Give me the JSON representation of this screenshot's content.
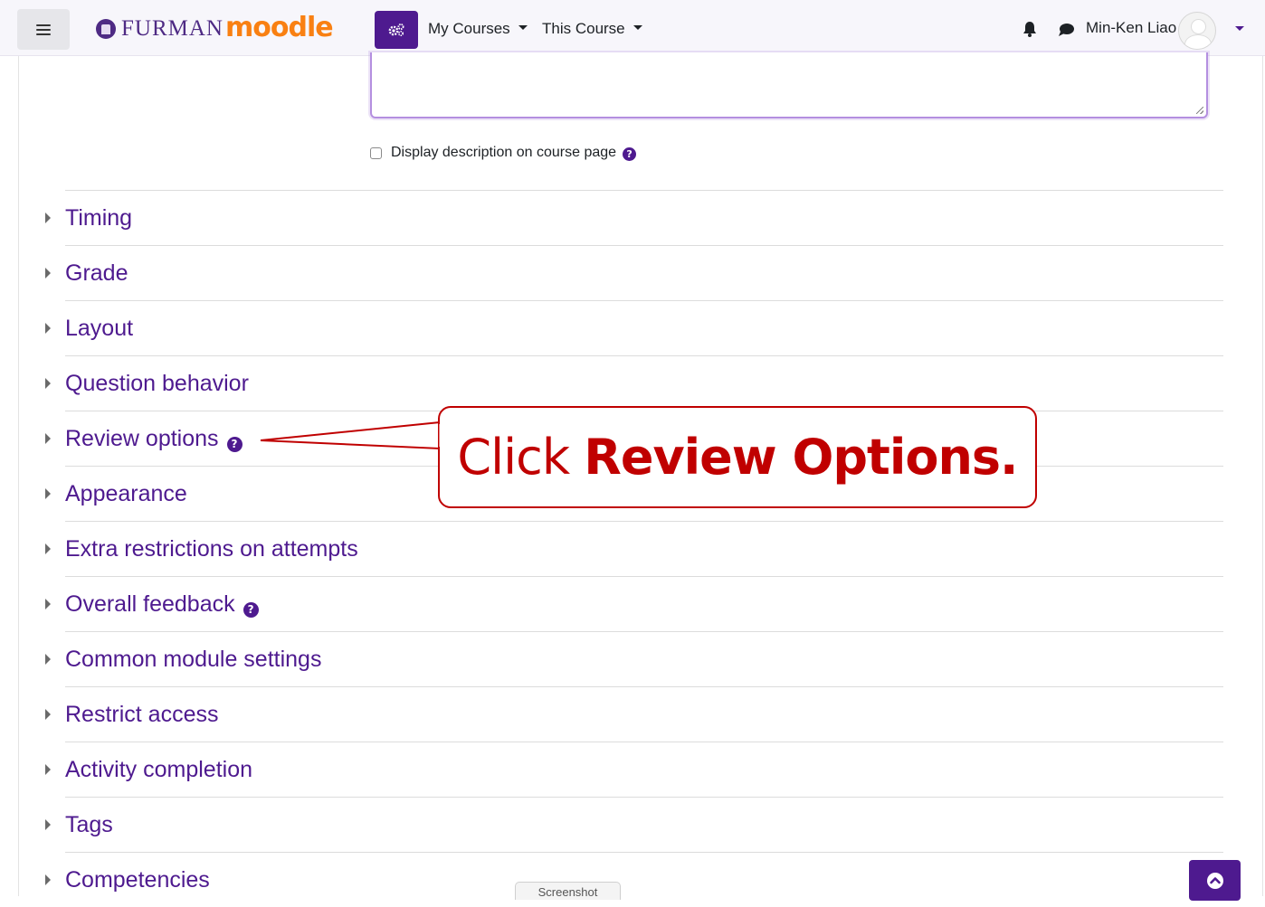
{
  "navbar": {
    "brand_furman": "FURMAN",
    "brand_moodle": "moodle",
    "my_courses": "My Courses",
    "this_course": "This Course",
    "user_name": "Min-Ken Liao"
  },
  "form": {
    "display_description_label": "Display description on course page"
  },
  "sections": [
    {
      "title": "Timing",
      "help": false
    },
    {
      "title": "Grade",
      "help": false
    },
    {
      "title": "Layout",
      "help": false
    },
    {
      "title": "Question behavior",
      "help": false
    },
    {
      "title": "Review options",
      "help": true
    },
    {
      "title": "Appearance",
      "help": false
    },
    {
      "title": "Extra restrictions on attempts",
      "help": false
    },
    {
      "title": "Overall feedback",
      "help": true
    },
    {
      "title": "Common module settings",
      "help": false
    },
    {
      "title": "Restrict access",
      "help": false
    },
    {
      "title": "Activity completion",
      "help": false
    },
    {
      "title": "Tags",
      "help": false
    },
    {
      "title": "Competencies",
      "help": false
    }
  ],
  "callout": {
    "prefix": "Click ",
    "emphasis": "Review Options."
  },
  "footer": {
    "screenshot_tab": "Screenshot"
  },
  "icons": {
    "help": "?",
    "menu": "hamburger-icon",
    "admin": "gears-icon",
    "notifications": "bell-icon",
    "messages": "chat-bubble-icon",
    "back_to_top": "arrow-up-icon"
  },
  "colors": {
    "accent": "#4e1a8f",
    "callout_red": "#c00000",
    "moodle_orange": "#f98012"
  }
}
